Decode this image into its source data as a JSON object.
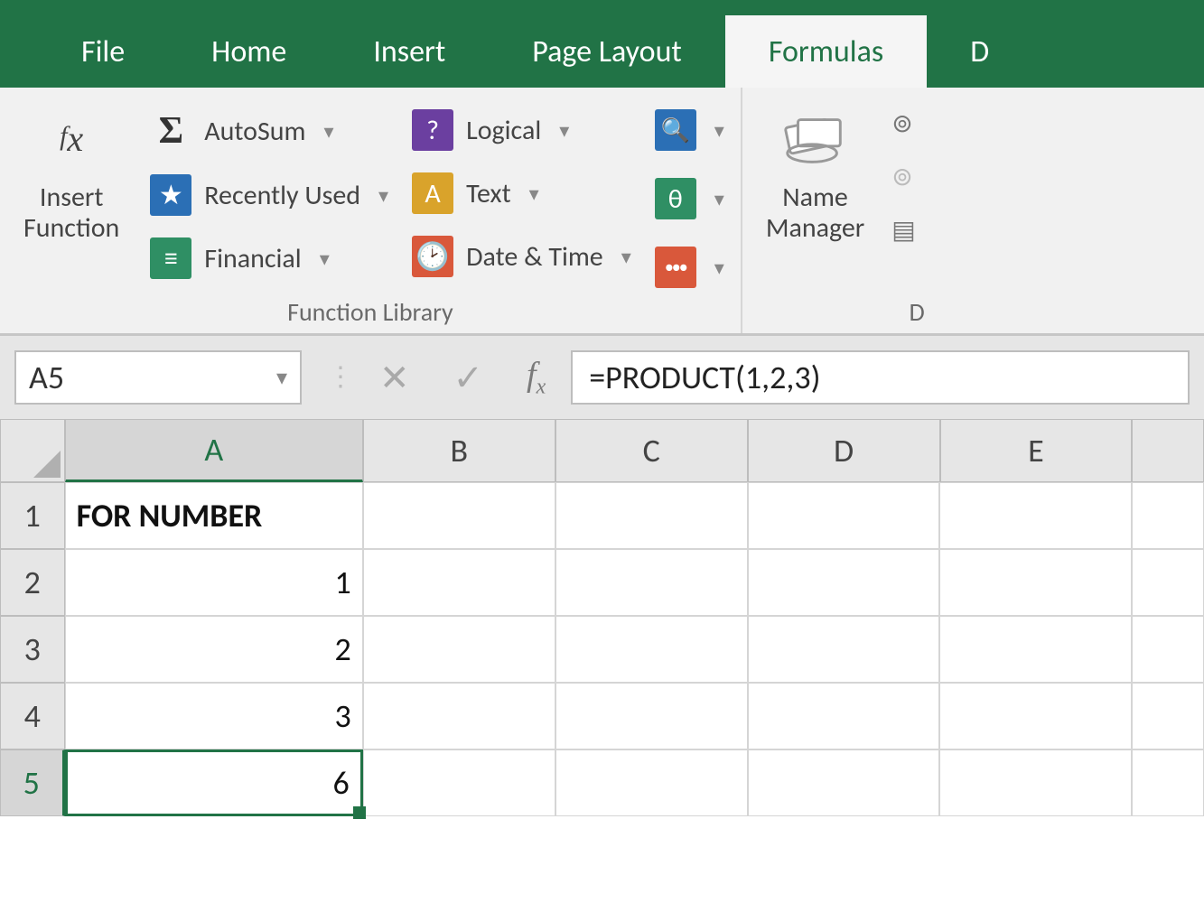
{
  "tabs": {
    "file": "File",
    "home": "Home",
    "insert": "Insert",
    "pagelayout": "Page Layout",
    "formulas": "Formulas",
    "data_cut": "D"
  },
  "ribbon": {
    "insertFunction": {
      "line1": "Insert",
      "line2": "Function"
    },
    "autosum": "AutoSum",
    "recentlyUsed": "Recently Used",
    "financial": "Financial",
    "logical": "Logical",
    "text": "Text",
    "dateTime": "Date & Time",
    "groupFunctionLibrary": "Function Library",
    "nameManager": {
      "line1": "Name",
      "line2": "Manager"
    },
    "definedGroupCut": "D"
  },
  "namebox": "A5",
  "formula": "=PRODUCT(1,2,3)",
  "columns": [
    "A",
    "B",
    "C",
    "D",
    "E"
  ],
  "rows": {
    "r1": {
      "num": "1",
      "A": "FOR NUMBER"
    },
    "r2": {
      "num": "2",
      "A": "1"
    },
    "r3": {
      "num": "3",
      "A": "2"
    },
    "r4": {
      "num": "4",
      "A": "3"
    },
    "r5": {
      "num": "5",
      "A": "6"
    }
  },
  "selectedCell": "A5"
}
